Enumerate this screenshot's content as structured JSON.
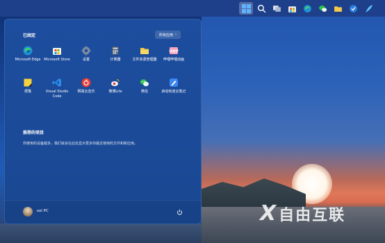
{
  "taskbar": {
    "icons": [
      "windows-start",
      "search",
      "task-view",
      "store",
      "edge",
      "wechat",
      "file-explorer",
      "security",
      "feather"
    ]
  },
  "start_menu": {
    "pinned_title": "已固定",
    "all_apps_label": "所有应用",
    "all_apps_chevron": "›",
    "apps": [
      {
        "label": "Microsoft Edge",
        "icon": "edge-icon",
        "color": "#1f8fd4"
      },
      {
        "label": "Microsoft Store",
        "icon": "store-icon",
        "color": "#f3f3f3"
      },
      {
        "label": "设置",
        "icon": "gear-icon",
        "color": "#6f7f95"
      },
      {
        "label": "计算器",
        "icon": "calculator-icon",
        "color": "#4a5668"
      },
      {
        "label": "文件资源管理器",
        "icon": "folder-icon",
        "color": "#f2c94c"
      },
      {
        "label": "哔哩哔哩动画",
        "icon": "bilibili-icon",
        "color": "#f6a3c0"
      },
      {
        "label": "便笺",
        "icon": "sticky-notes-icon",
        "color": "#f5d33b"
      },
      {
        "label": "Visual Studio Code",
        "icon": "vscode-icon",
        "color": "#2b8ce8"
      },
      {
        "label": "网易云音乐",
        "icon": "netease-music-icon",
        "color": "#e83a35"
      },
      {
        "label": "微博Lite",
        "icon": "weibo-icon",
        "color": "#f6f6f6"
      },
      {
        "label": "微信",
        "icon": "wechat-icon",
        "color": "#2dc04f"
      },
      {
        "label": "启动有道云笔记",
        "icon": "youdao-note-icon",
        "color": "#3b86f2"
      }
    ],
    "recommended_title": "推荐的项目",
    "recommended_desc": "你使用的设备越多，我们就会在此处显示更多你最近使用的文件和新应用。",
    "user_name": "soi PC"
  },
  "watermark": {
    "glyph": "X",
    "text": "自由互联"
  }
}
